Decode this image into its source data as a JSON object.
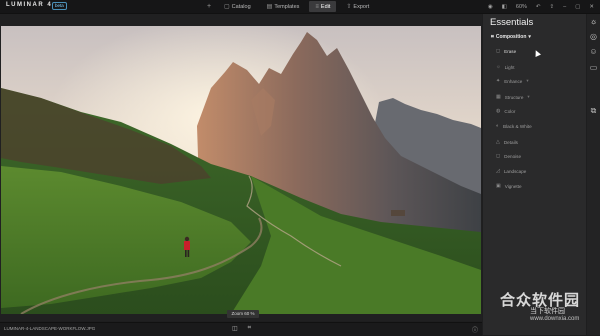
{
  "app": {
    "logo": "LUMINAR 4",
    "badge": "beta"
  },
  "nav": {
    "plus": "+",
    "items": [
      {
        "label": "Catalog",
        "icon": "catalog-icon"
      },
      {
        "label": "Templates",
        "icon": "templates-icon"
      },
      {
        "label": "Edit",
        "icon": "edit-icon",
        "active": true
      },
      {
        "label": "Export",
        "icon": "export-icon"
      }
    ]
  },
  "top_right": {
    "zoom_value": "60%"
  },
  "photo": {
    "zoom_label": "Zoom 60 %"
  },
  "bottom": {
    "filename": "LUMINAR-4-LANDSCAPE-WORKFLOW.JPG"
  },
  "panel": {
    "title": "Essentials",
    "section": "Composition",
    "tools": [
      {
        "label": "Erase",
        "icon": "erase-icon",
        "active": true
      },
      {
        "label": "Light",
        "icon": "light-icon"
      },
      {
        "label": "Enhance",
        "icon": "enhance-icon",
        "caret": true
      },
      {
        "label": "Structure",
        "icon": "structure-icon",
        "caret": true
      },
      {
        "label": "Color",
        "icon": "color-icon"
      },
      {
        "label": "Black & White",
        "icon": "bw-icon"
      },
      {
        "label": "Details",
        "icon": "details-icon"
      },
      {
        "label": "Denoise",
        "icon": "denoise-icon"
      },
      {
        "label": "Landscape",
        "icon": "landscape-icon"
      },
      {
        "label": "Vignette",
        "icon": "vignette-icon"
      }
    ]
  },
  "watermark": {
    "main": "合众软件园",
    "sub": "当下软件园",
    "url": "www.downxia.com"
  },
  "colors": {
    "accent": "#4a90b8",
    "panel": "#2a2a2b",
    "bg": "#1e1e1f"
  }
}
